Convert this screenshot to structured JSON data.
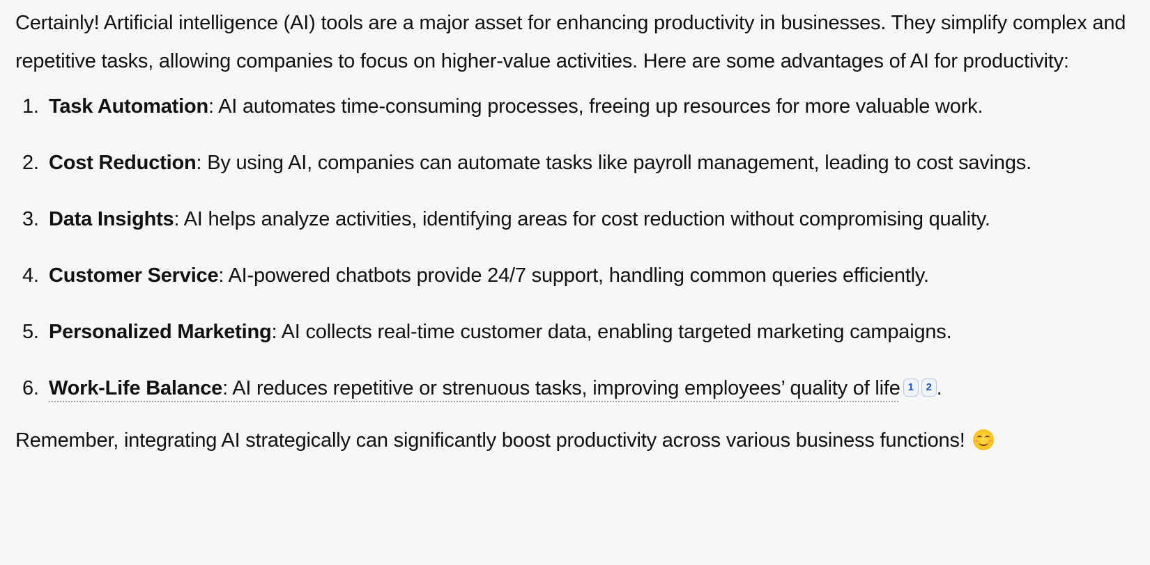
{
  "message": {
    "intro": "Certainly! Artificial intelligence (AI) tools are a major asset for enhancing productivity in businesses. They simplify complex and repetitive tasks, allowing companies to focus on higher-value activities. Here are some advantages of AI for productivity:",
    "items": [
      {
        "number": "1.",
        "title": "Task Automation",
        "text": ": AI automates time-consuming processes, freeing up resources for more valuable work."
      },
      {
        "number": "2.",
        "title": "Cost Reduction",
        "text": ": By using AI, companies can automate tasks like payroll management, leading to cost savings."
      },
      {
        "number": "3.",
        "title": "Data Insights",
        "text": ": AI helps analyze activities, identifying areas for cost reduction without compromising quality."
      },
      {
        "number": "4.",
        "title": "Customer Service",
        "text": ": AI-powered chatbots provide 24/7 support, handling common queries efficiently."
      },
      {
        "number": "5.",
        "title": "Personalized Marketing",
        "text": ": AI collects real-time customer data, enabling targeted marketing campaigns."
      },
      {
        "number": "6.",
        "title": "Work-Life Balance",
        "text": ": AI reduces repetitive or strenuous tasks, improving employees’ quality of life",
        "citations": [
          "1",
          "2"
        ],
        "trailing": "."
      }
    ],
    "closing": "Remember, integrating AI strategically can significantly boost productivity across various business functions!",
    "closing_emoji": "smiling-face-icon"
  }
}
